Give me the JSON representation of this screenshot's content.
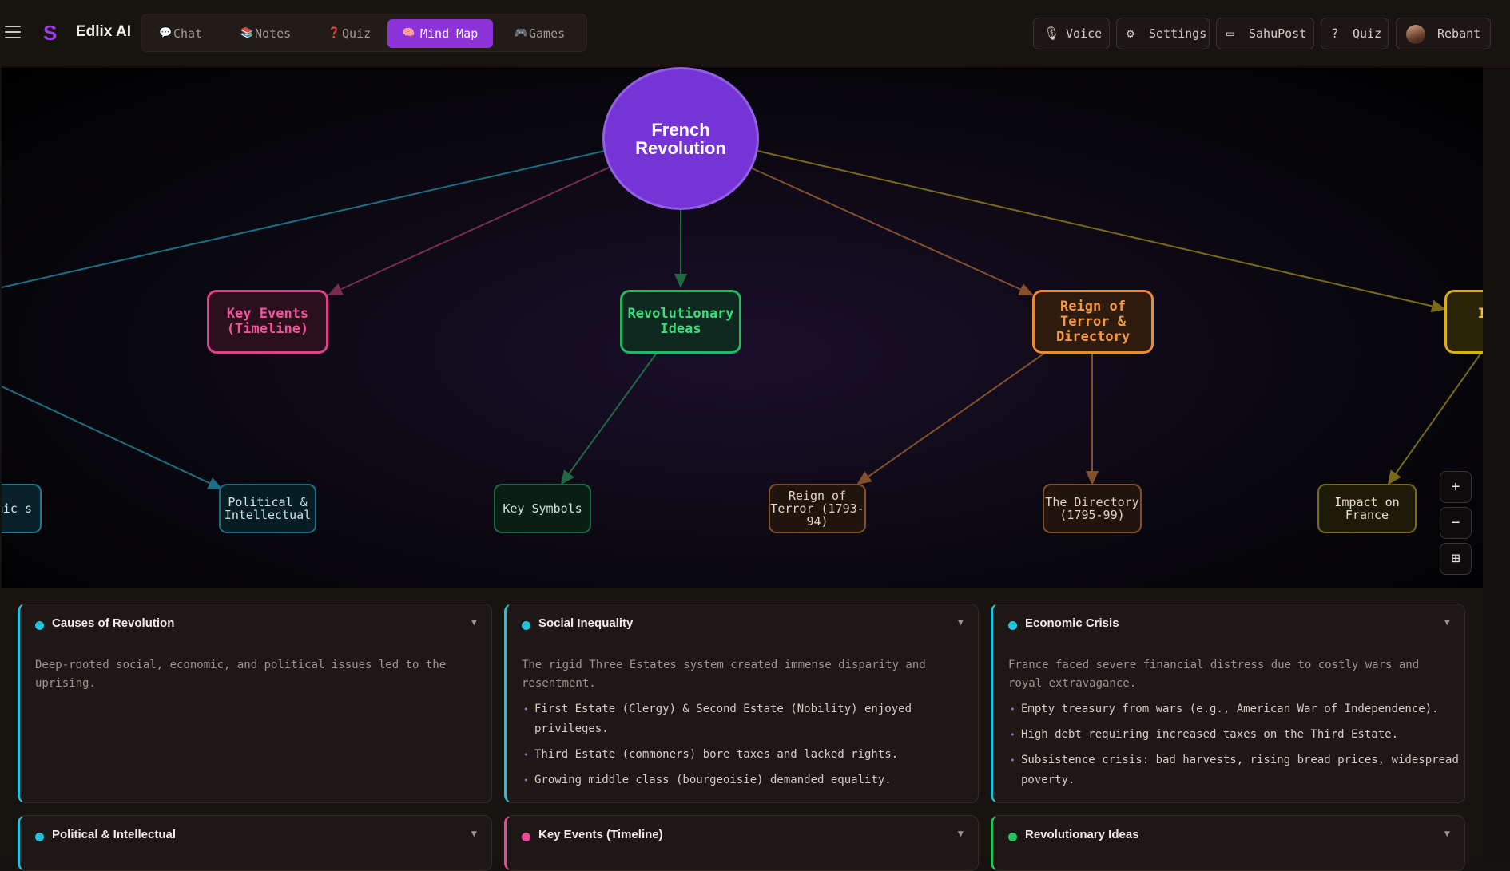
{
  "app": {
    "logo_glyph": "S",
    "name": "Edlix AI"
  },
  "nav": {
    "tabs": [
      {
        "label": "Chat",
        "icon": "💬"
      },
      {
        "label": "Notes",
        "icon": "📚"
      },
      {
        "label": "Quiz",
        "icon": "❓"
      },
      {
        "label": "Mind Map",
        "icon": "🧠",
        "active": true
      },
      {
        "label": "Games",
        "icon": "🎮"
      }
    ]
  },
  "topright": {
    "voice": "Voice",
    "settings": "Settings",
    "post": "SahuPost",
    "quiz": "Quiz",
    "user": "Rebant"
  },
  "mindmap": {
    "root": "French Revolution",
    "level1": {
      "key_events": "Key Events (Timeline)",
      "revolutionary_ideas": "Revolutionary Ideas",
      "reign_directory": "Reign of Terror & Directory",
      "impact_partial": "In L"
    },
    "level2": {
      "economic_partial": "mic s",
      "political": "Political & Intellectual",
      "key_symbols": "Key Symbols",
      "reign_terror": "Reign of Terror (1793-94)",
      "directory": "The Directory (1795-99)",
      "impact_france": "Impact on France"
    },
    "colors": {
      "root": "#7634d6",
      "cyan": "#1fa8c7",
      "pink": "#ec4899",
      "green": "#22c55e",
      "orange": "#f08a2e",
      "yellow": "#eab308"
    }
  },
  "zoom": {
    "in": "+",
    "out": "−",
    "fit": "⊞"
  },
  "cards": [
    {
      "title": "Causes of Revolution",
      "color": "#22c1dc",
      "desc": "Deep-rooted social, economic, and political issues led to the uprising.",
      "bullets": []
    },
    {
      "title": "Social Inequality",
      "color": "#22c1dc",
      "desc": "The rigid Three Estates system created immense disparity and resentment.",
      "bullets": [
        "First Estate (Clergy) & Second Estate (Nobility) enjoyed privileges.",
        "Third Estate (commoners) bore taxes and lacked rights.",
        "Growing middle class (bourgeoisie) demanded equality."
      ]
    },
    {
      "title": "Economic Crisis",
      "color": "#22c1dc",
      "desc": "France faced severe financial distress due to costly wars and royal extravagance.",
      "bullets": [
        "Empty treasury from wars (e.g., American War of Independence).",
        "High debt requiring increased taxes on the Third Estate.",
        "Subsistence crisis: bad harvests, rising bread prices, widespread poverty."
      ]
    },
    {
      "title": "Political & Intellectual",
      "color": "#22c1dc"
    },
    {
      "title": "Key Events (Timeline)",
      "color": "#ec4899"
    },
    {
      "title": "Revolutionary Ideas",
      "color": "#22c55e"
    }
  ]
}
